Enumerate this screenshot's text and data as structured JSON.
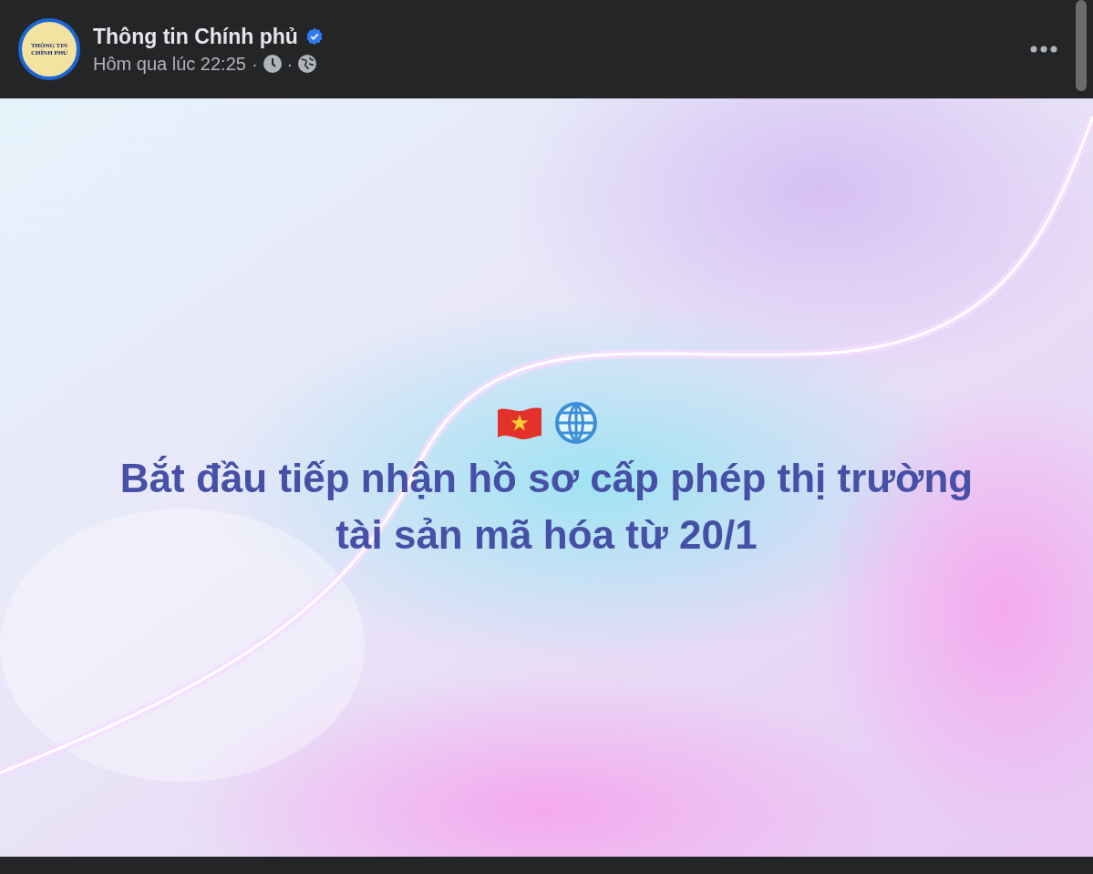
{
  "post": {
    "avatar": {
      "lines": [
        "THÔNG TIN",
        "CHÍNH PHỦ"
      ]
    },
    "author": "Thông tin Chính phủ",
    "verified": true,
    "time": "Hôm qua lúc 22:25",
    "separators": [
      "·",
      "·"
    ],
    "media": {
      "kind": "picture",
      "headline_lines": [
        "Bắt đầu tiếp nhận hồ sơ cấp phép thị trường",
        "tài sản mã hóa từ 20/1"
      ]
    }
  }
}
